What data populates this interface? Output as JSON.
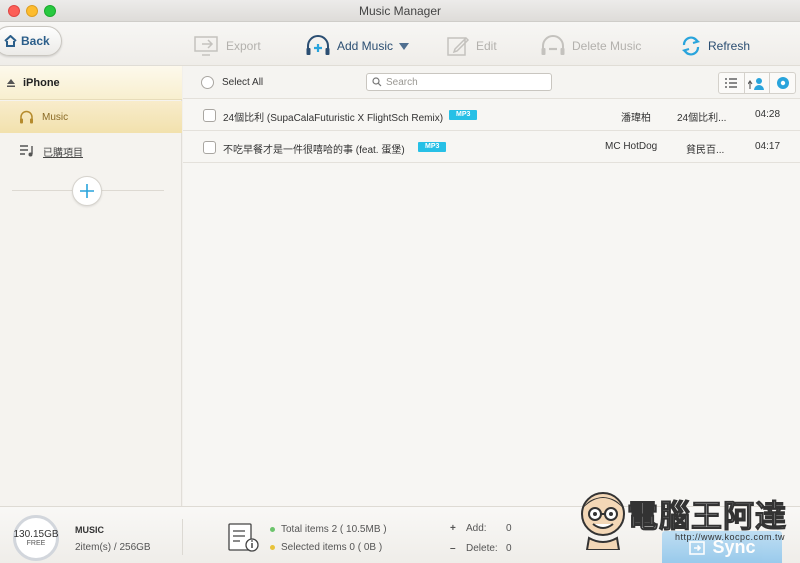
{
  "window": {
    "title": "Music Manager"
  },
  "toolbar": {
    "back_label": "Back",
    "export_label": "Export",
    "add_music_label": "Add Music",
    "edit_label": "Edit",
    "delete_label": "Delete Music",
    "refresh_label": "Refresh",
    "accent_color": "#2b4e72"
  },
  "sidebar": {
    "device_name": "iPhone",
    "items": [
      {
        "label": "Music",
        "icon": "headphones-icon",
        "selected": true
      },
      {
        "label": "已購項目",
        "icon": "playlist-icon",
        "selected": false
      }
    ]
  },
  "list": {
    "select_all_label": "Select All",
    "search_placeholder": "Search",
    "tracks": [
      {
        "title": "24個比利 (SupaCalaFuturistic X FlightSch Remix)",
        "format": "MP3",
        "artist": "潘瑋柏",
        "album": "24個比利...",
        "duration": "04:28"
      },
      {
        "title": "不吃早餐才是一件很嘻哈的事 (feat. 蛋堡)",
        "format": "MP3",
        "artist": "MC HotDog",
        "album": "貧民百...",
        "duration": "04:17"
      }
    ]
  },
  "status": {
    "free_space": "130.15GB",
    "free_label": "FREE",
    "category": "MUSIC",
    "usage": "2item(s) / 256GB",
    "total_items": "Total items 2 ( 10.5MB )",
    "selected_items": "Selected items 0 ( 0B )",
    "add_label": "Add:",
    "add_count": "0",
    "delete_label": "Delete:",
    "delete_count": "0",
    "sync_label": "Sync"
  },
  "watermark": {
    "text": "電腦王阿達",
    "url": "http://www.kocpc.com.tw"
  },
  "colors": {
    "badge": "#27c0e6",
    "total_dot": "#6cc46c",
    "selected_dot": "#e8c33a"
  }
}
